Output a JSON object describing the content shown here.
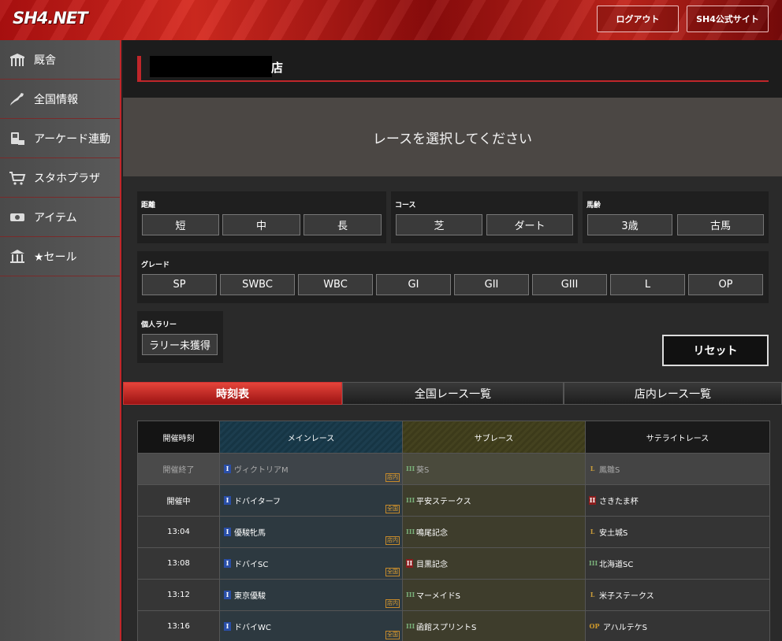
{
  "header": {
    "logo": "SH4.NET",
    "logout_label": "ログアウト",
    "official_label": "SH4公式サイト"
  },
  "sidebar": {
    "items": [
      {
        "label": "厩舎",
        "icon": "stable-icon"
      },
      {
        "label": "全国情報",
        "icon": "japan-map-icon"
      },
      {
        "label": "アーケード連動",
        "icon": "arcade-icon"
      },
      {
        "label": "スタホプラザ",
        "icon": "cart-icon"
      },
      {
        "label": "アイテム",
        "icon": "ticket-icon"
      },
      {
        "label": "★セール",
        "icon": "bank-icon"
      }
    ]
  },
  "shop": {
    "suffix": "店"
  },
  "prompt": "レースを選択してください",
  "filters": {
    "distance": {
      "label": "距離",
      "options": [
        "短",
        "中",
        "長"
      ]
    },
    "course": {
      "label": "コース",
      "options": [
        "芝",
        "ダート"
      ]
    },
    "age": {
      "label": "馬齢",
      "options": [
        "3歳",
        "古馬"
      ]
    },
    "grade": {
      "label": "グレード",
      "options": [
        "SP",
        "SWBC",
        "WBC",
        "GI",
        "GII",
        "GIII",
        "L",
        "OP"
      ]
    },
    "rally": {
      "label": "個人ラリー",
      "options": [
        "ラリー未獲得"
      ]
    },
    "reset_label": "リセット"
  },
  "tabs": [
    "時刻表",
    "全国レース一覧",
    "店内レース一覧"
  ],
  "table": {
    "headers": [
      "開催時刻",
      "メインレース",
      "サブレース",
      "サテライトレース"
    ],
    "rows": [
      {
        "time": "開催終了",
        "state": "ended",
        "main": {
          "grade": "I",
          "name": "ヴィクトリアM",
          "badge": "店内"
        },
        "sub": {
          "grade": "III",
          "name": "葵S"
        },
        "sat": {
          "grade": "L",
          "name": "鳳雛S"
        }
      },
      {
        "time": "開催中",
        "state": "live",
        "main": {
          "grade": "I",
          "name": "ドバイターフ",
          "badge": "全国"
        },
        "sub": {
          "grade": "III",
          "name": "平安ステークス"
        },
        "sat": {
          "grade": "II",
          "name": "さきたま杯"
        }
      },
      {
        "time": "13:04",
        "state": "",
        "main": {
          "grade": "I",
          "name": "優駿牝馬",
          "badge": "店内"
        },
        "sub": {
          "grade": "III",
          "name": "鳴尾記念"
        },
        "sat": {
          "grade": "L",
          "name": "安土城S"
        }
      },
      {
        "time": "13:08",
        "state": "",
        "main": {
          "grade": "I",
          "name": "ドバイSC",
          "badge": "全国"
        },
        "sub": {
          "grade": "II",
          "name": "目黒記念"
        },
        "sat": {
          "grade": "III",
          "name": "北海道SC"
        }
      },
      {
        "time": "13:12",
        "state": "",
        "main": {
          "grade": "I",
          "name": "東京優駿",
          "badge": "店内"
        },
        "sub": {
          "grade": "III",
          "name": "マーメイドS"
        },
        "sat": {
          "grade": "L",
          "name": "米子ステークス"
        }
      },
      {
        "time": "13:16",
        "state": "",
        "main": {
          "grade": "I",
          "name": "ドバイWC",
          "badge": "全国"
        },
        "sub": {
          "grade": "III",
          "name": "函館スプリントS"
        },
        "sat": {
          "grade": "OP",
          "name": "アハルテケS"
        }
      }
    ]
  },
  "colors": {
    "accent_red": "#c0262a",
    "live_highlight": "#cde07a",
    "grade1": "#2a4fa8",
    "grade2": "#8c1d1d",
    "grade3": "#2a7a3a"
  }
}
